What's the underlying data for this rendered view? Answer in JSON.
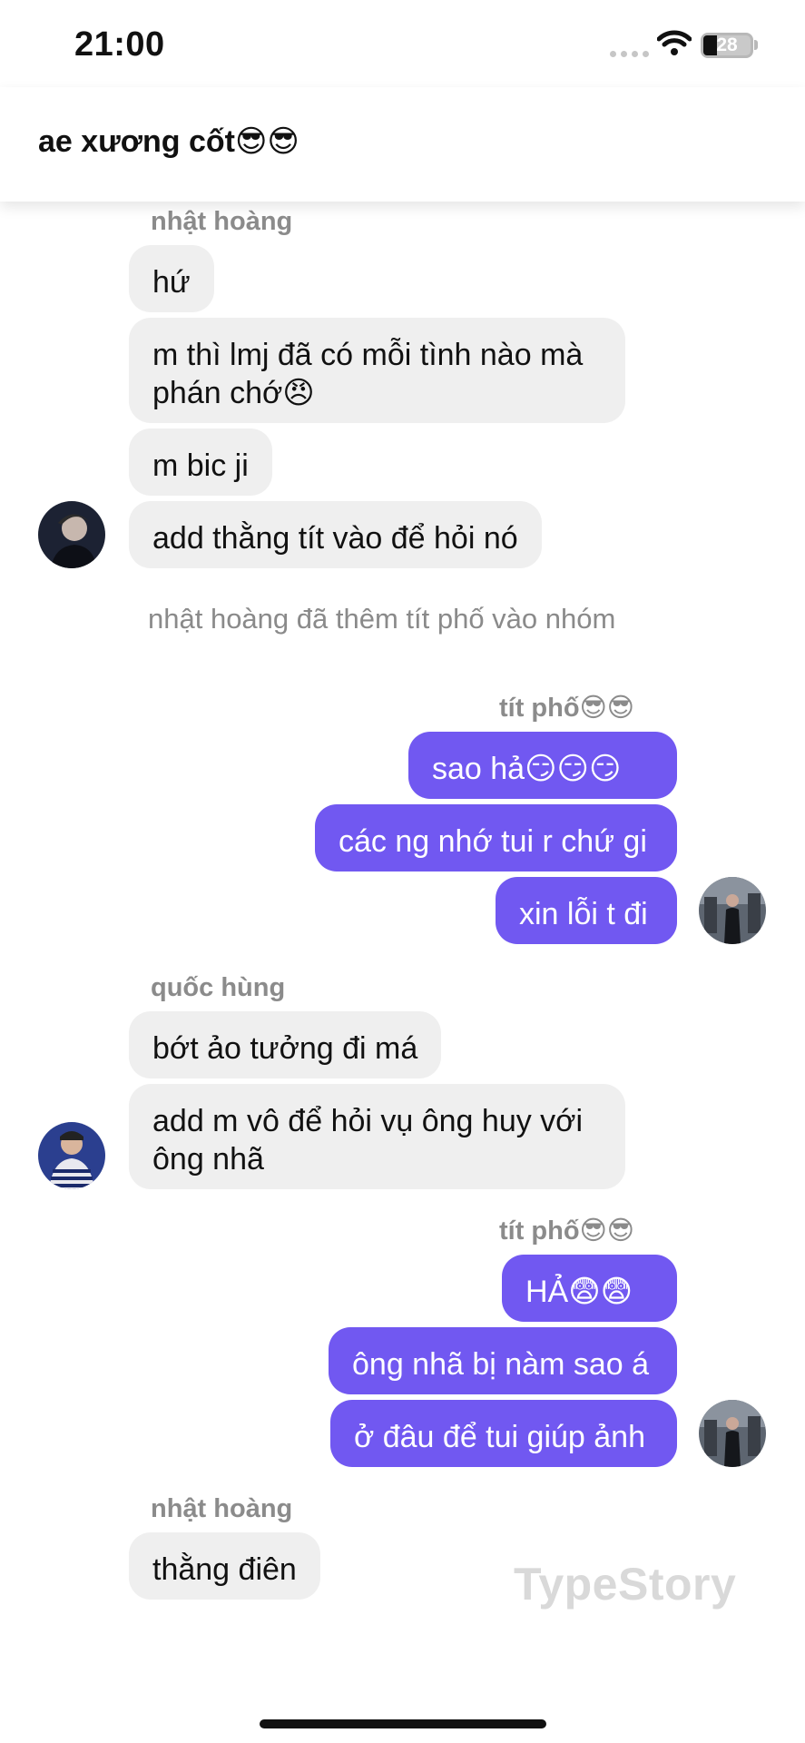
{
  "status_bar": {
    "time": "21:00",
    "battery_level": "28",
    "battery_fraction": 0.28,
    "icons": [
      "cellular-signal-icon",
      "wifi-icon",
      "battery-icon"
    ]
  },
  "header": {
    "title": "ae xương cốt😎😎"
  },
  "colors": {
    "outgoing_bubble": "#7158f1",
    "incoming_bubble": "#efefef",
    "sender_name": "#8b8b8b",
    "system_text": "#8a8a8a"
  },
  "messages": {
    "group1": {
      "sender": "nhật hoàng",
      "bubbles": [
        "hứ",
        "m thì lmj đã có mỗi tình nào mà",
        "phán chớ😠",
        "m bic ji",
        "add thằng tít vào để hỏi nó"
      ]
    },
    "system1": "nhật hoàng đã thêm tít phố vào nhóm",
    "group2": {
      "sender": "tít phố😎😎",
      "bubbles": [
        "sao hả😏😏😏",
        "các ng nhớ tui r chứ gi",
        "xin lỗi t đi"
      ]
    },
    "group3": {
      "sender": "quốc hùng",
      "bubbles": [
        "bớt ảo tưởng đi má",
        "add m vô để hỏi vụ ông huy với",
        "ông nhã"
      ]
    },
    "group4": {
      "sender": "tít phố😎😎",
      "bubbles": [
        "HẢ😨😨",
        "ông nhã bị nàm sao á",
        "ở đâu để tui giúp ảnh"
      ]
    },
    "group5": {
      "sender": "nhật hoàng",
      "bubbles": [
        "thằng điên"
      ]
    }
  },
  "watermark": "TypeStory"
}
